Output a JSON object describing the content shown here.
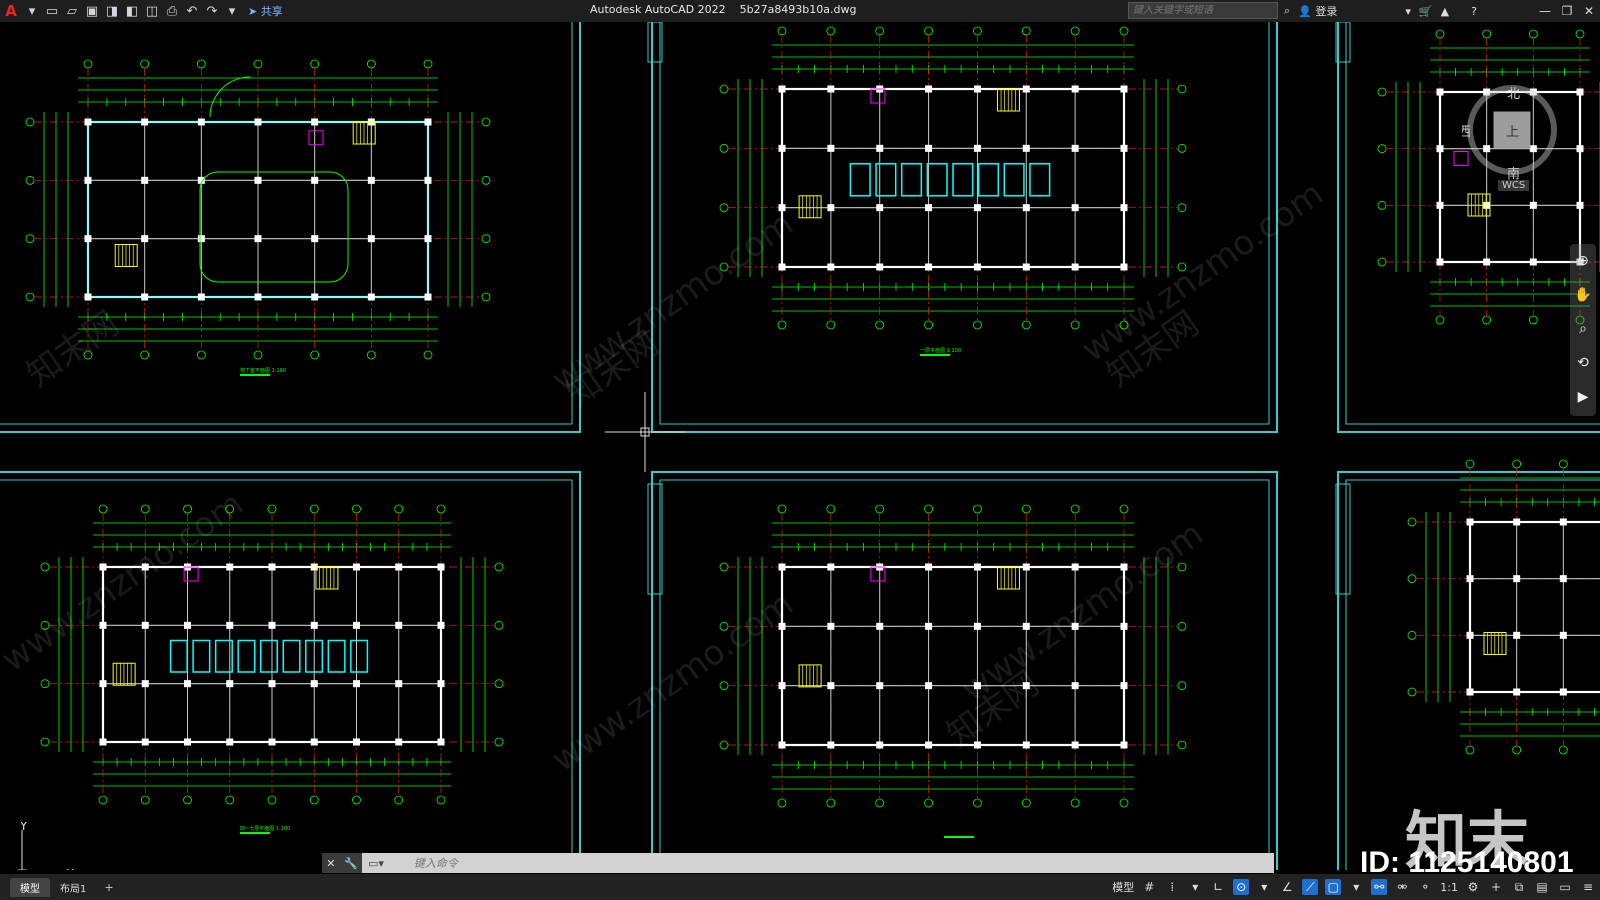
{
  "title_bar": {
    "app_name": "Autodesk AutoCAD 2022",
    "file_name": "5b27a8493b10a.dwg",
    "share_label": "共享",
    "search_placeholder": "键入关键字或短语",
    "login_label": "登录"
  },
  "quick_access": [
    "new-icon",
    "open-icon",
    "save-icon",
    "save-as-icon",
    "open-web-icon",
    "save-web-icon",
    "print-icon",
    "undo-icon",
    "redo-icon",
    "customize-icon"
  ],
  "window_controls": [
    "minimize",
    "restore",
    "close"
  ],
  "viewcube": {
    "north": "北",
    "west": "西",
    "top": "上",
    "south": "南",
    "ucs": "WCS"
  },
  "drawings": [
    {
      "id": "plan-1",
      "caption": "地下室平面图 1:100"
    },
    {
      "id": "plan-2",
      "caption": "一层平面图 1:100"
    },
    {
      "id": "plan-4",
      "caption": "四~七层平面图 1:100"
    },
    {
      "id": "plan-5",
      "caption": ""
    }
  ],
  "ucs_labels": {
    "x": "X",
    "y": "Y"
  },
  "command_line": {
    "placeholder": "键入命令"
  },
  "layout_tabs": [
    {
      "label": "模型",
      "active": true
    },
    {
      "label": "布局1",
      "active": false
    }
  ],
  "status_bar": {
    "model_label": "模型",
    "scale": "1:1"
  },
  "watermark": {
    "text": "www.znzmo.com",
    "cn_text": "知末网",
    "logo": "知末",
    "id_text": "ID: 1125140801"
  },
  "colors": {
    "frame": "#3cc",
    "wall": "#fff",
    "dimension": "#0f0",
    "axis": "#e02020",
    "furniture": "#0ff",
    "stairs": "#ff0",
    "magenta": "#f0f"
  }
}
